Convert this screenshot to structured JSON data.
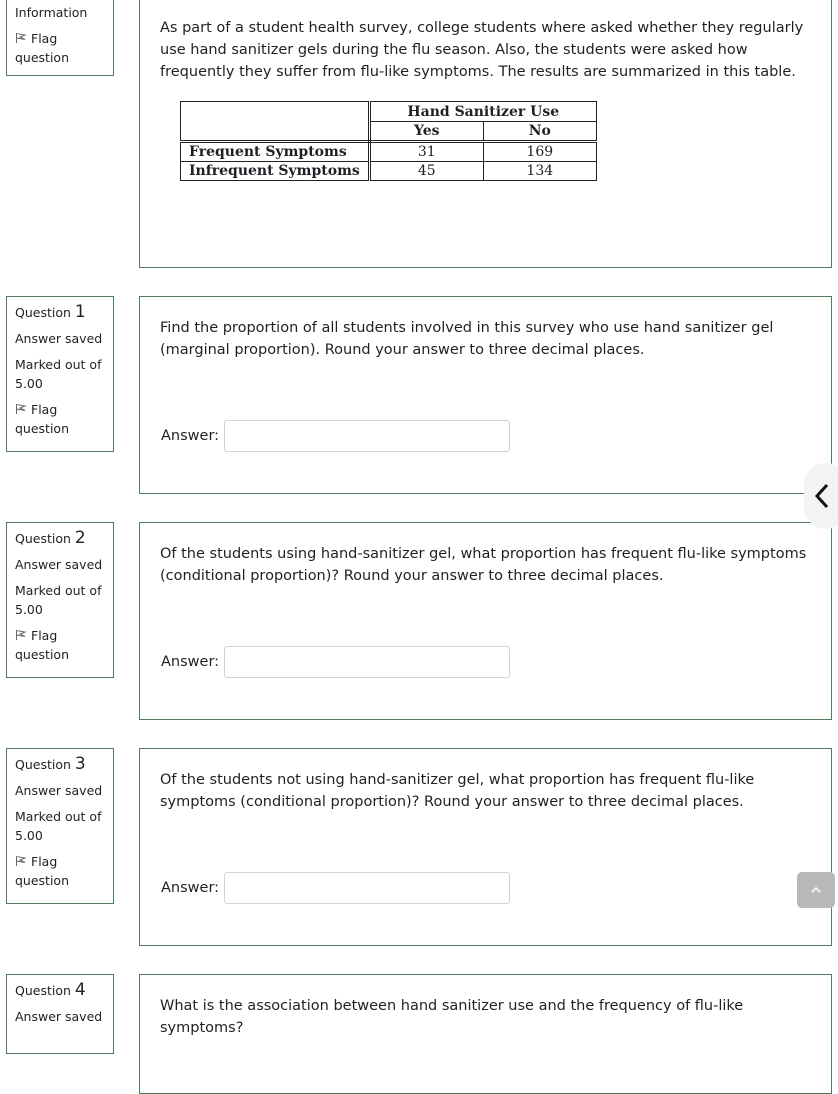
{
  "info_block": {
    "title": "Information",
    "flag_label": "Flag question",
    "text": "As part of a student health survey, college students where asked whether they regularly use hand sanitizer gels during the flu season. Also, the students were asked how frequently they suffer from flu-like symptoms. The results are summarized in this table.",
    "table": {
      "group_header": "Hand Sanitizer Use",
      "columns": [
        "Yes",
        "No"
      ],
      "rows": [
        {
          "label": "Frequent Symptoms",
          "values": [
            "31",
            "169"
          ]
        },
        {
          "label": "Infrequent Symptoms",
          "values": [
            "45",
            "134"
          ]
        }
      ]
    }
  },
  "questions": [
    {
      "prefix": "Question",
      "number": "1",
      "status": "Answer saved",
      "marks": "Marked out of 5.00",
      "flag_label": "Flag question",
      "text": "Find the proportion of all students involved in this survey who use hand sanitizer gel (marginal proportion). Round your answer to three decimal places.",
      "answer_label": "Answer:",
      "answer_value": ""
    },
    {
      "prefix": "Question",
      "number": "2",
      "status": "Answer saved",
      "marks": "Marked out of 5.00",
      "flag_label": "Flag question",
      "text": "Of the students using hand-sanitizer gel, what proportion has frequent flu-like symptoms (conditional proportion)? Round your answer to three decimal places.",
      "answer_label": "Answer:",
      "answer_value": ""
    },
    {
      "prefix": "Question",
      "number": "3",
      "status": "Answer saved",
      "marks": "Marked out of 5.00",
      "flag_label": "Flag question",
      "text": "Of the students not using hand-sanitizer gel, what proportion has frequent flu-like symptoms (conditional proportion)? Round your answer to three decimal places.",
      "answer_label": "Answer:",
      "answer_value": ""
    },
    {
      "prefix": "Question",
      "number": "4",
      "status": "Answer saved",
      "text": "What is the association between hand sanitizer use and the frequency of flu-like symptoms?"
    }
  ],
  "controls": {
    "drawer_toggle_icon": "chevron-left-icon",
    "back_to_top_icon": "chevron-up-icon"
  }
}
